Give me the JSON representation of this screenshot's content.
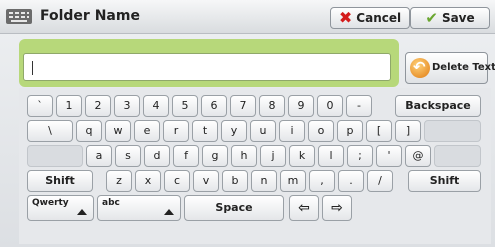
{
  "header": {
    "title": "Folder Name",
    "cancel_label": "Cancel",
    "save_label": "Save"
  },
  "input": {
    "value": ""
  },
  "delete_label": "Delete Text",
  "keyboard": {
    "row1": [
      "`",
      "1",
      "2",
      "3",
      "4",
      "5",
      "6",
      "7",
      "8",
      "9",
      "0",
      "-"
    ],
    "backspace_label": "Backspace",
    "row2": [
      "\\",
      "q",
      "w",
      "e",
      "r",
      "t",
      "y",
      "u",
      "i",
      "o",
      "p",
      "[",
      "]"
    ],
    "row3": [
      "a",
      "s",
      "d",
      "f",
      "g",
      "h",
      "j",
      "k",
      "l",
      ";",
      "'",
      "@"
    ],
    "shift_label": "Shift",
    "row4": [
      "z",
      "x",
      "c",
      "v",
      "b",
      "n",
      "m",
      ",",
      ".",
      "/"
    ],
    "layout_label": "Qwerty",
    "charset_label": "abc",
    "space_label": "Space",
    "left_arrow": "⇦",
    "right_arrow": "⇨"
  }
}
